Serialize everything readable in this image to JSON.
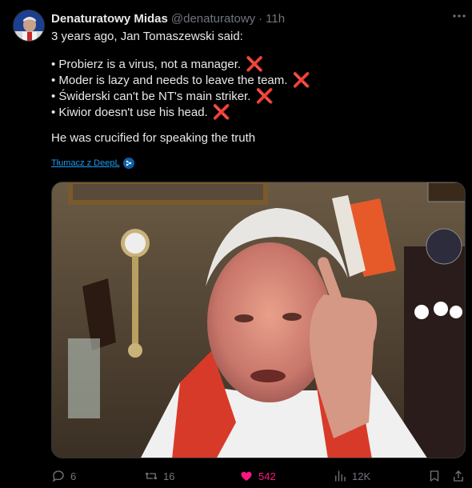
{
  "author": {
    "name": "Denaturatowy Midas",
    "handle": "@denaturatowy",
    "separator": "·",
    "time": "11h"
  },
  "tweet": {
    "intro": "3 years ago, Jan Tomaszewski said:",
    "bullets": [
      "• Probierz is a virus, not a manager.",
      "• Moder is lazy and needs to leave the team.",
      "• Świderski can't be NT's main striker.",
      "• Kiwior doesn't use his head."
    ],
    "bullet_mark": "❌",
    "conclusion": "He was crucified for speaking the truth",
    "translate_label": "Tłumacz z DeepL"
  },
  "actions": {
    "replies": "6",
    "reposts": "16",
    "likes": "542",
    "views": "12K"
  },
  "colors": {
    "background": "#000000",
    "text": "#e7e9ea",
    "muted": "#71767b",
    "link": "#1d9bf0",
    "like": "#f91880",
    "cross": "#e0245e"
  }
}
